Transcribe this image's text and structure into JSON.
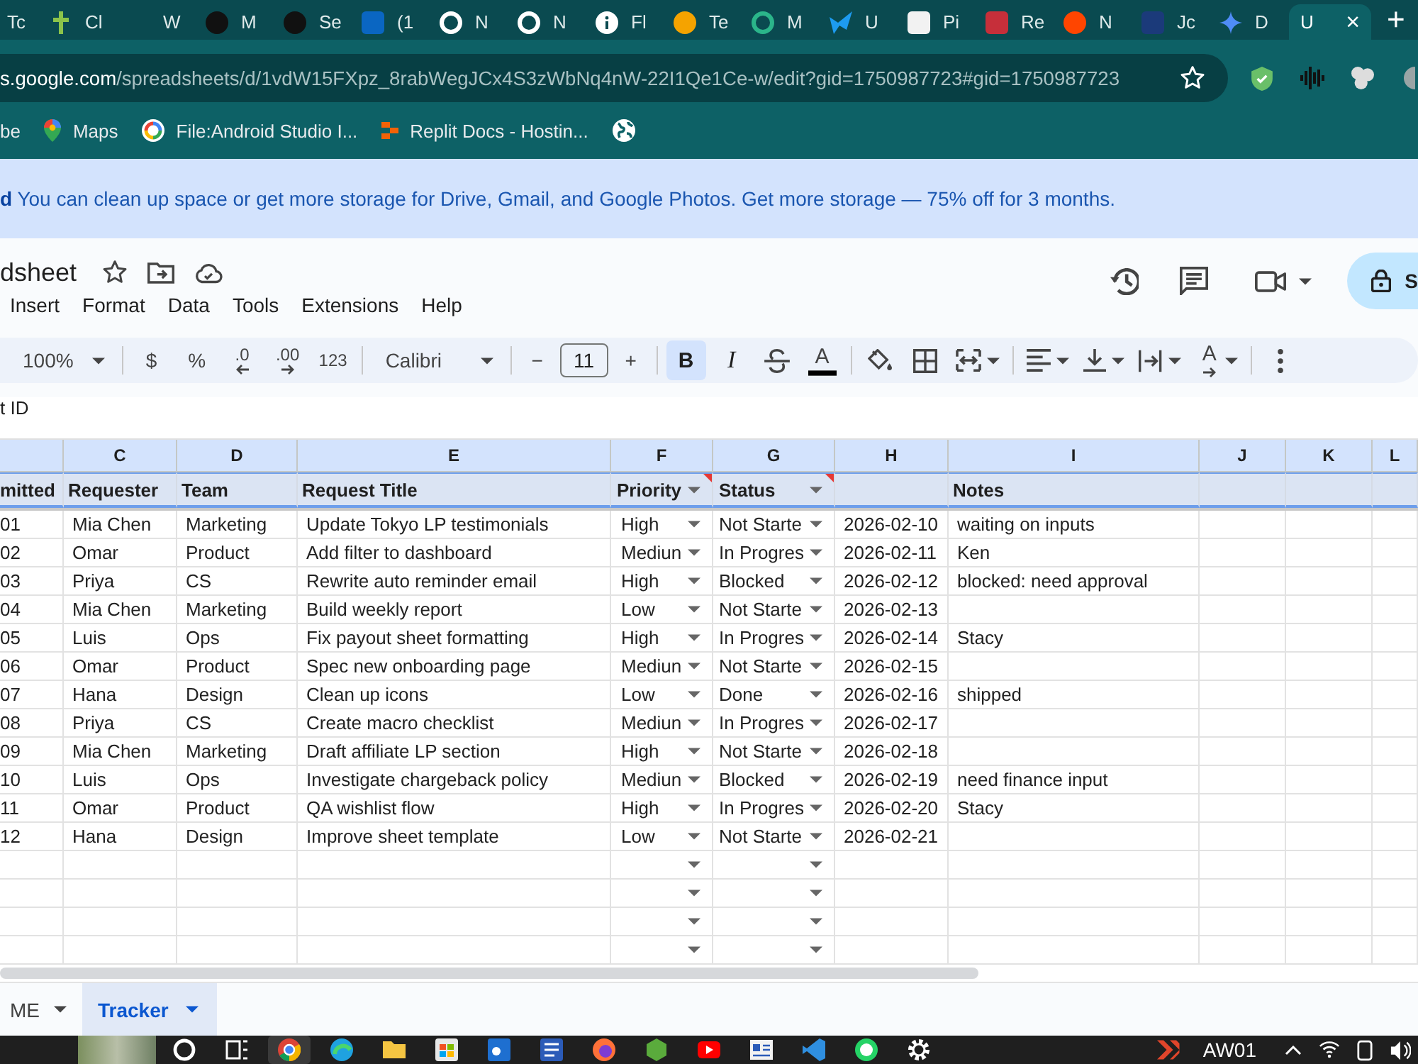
{
  "tabs": [
    {
      "label": "Tc",
      "selected": false
    },
    {
      "label": "Cl",
      "kind": "cross",
      "color": "#8bc34a",
      "selected": false
    },
    {
      "label": "W",
      "selected": false
    },
    {
      "label": "M",
      "kind": "disc",
      "color": "#111111",
      "selected": false
    },
    {
      "label": "Se",
      "kind": "disc",
      "color": "#111111",
      "selected": false
    },
    {
      "label": "(1",
      "kind": "square",
      "color": "#0a66c2",
      "selected": false
    },
    {
      "label": "N",
      "kind": "ring",
      "color": "#ffffff",
      "selected": false
    },
    {
      "label": "N",
      "kind": "ring",
      "color": "#ffffff",
      "selected": false
    },
    {
      "label": "Fl",
      "kind": "info",
      "color": "#ffffff",
      "selected": false
    },
    {
      "label": "Te",
      "kind": "disc",
      "color": "#f5a300",
      "selected": false
    },
    {
      "label": "M",
      "kind": "ring",
      "color": "#2bb58a",
      "selected": false
    },
    {
      "label": "U",
      "kind": "bird",
      "color": "#1d9bf0",
      "selected": false
    },
    {
      "label": "Pi",
      "kind": "square",
      "color": "#f2f2f2",
      "selected": false
    },
    {
      "label": "Re",
      "kind": "square",
      "color": "#c62f3a",
      "selected": false
    },
    {
      "label": "N",
      "kind": "disc",
      "color": "#ff4500",
      "selected": false
    },
    {
      "label": "Jc",
      "kind": "square",
      "color": "#1b3a7a",
      "selected": false
    },
    {
      "label": "D",
      "kind": "sparkle",
      "color": "#4f8cf7",
      "selected": false
    },
    {
      "label": "U",
      "selected": true,
      "close": "×"
    }
  ],
  "new_tab": "+",
  "address_bar": {
    "host": "s.google.com",
    "path": "/spreadsheets/d/1vdW15FXpz_8rabWegJCx4S3zWbNq4nW-22I1Qe1Ce-w/edit?gid=1750987723#gid=1750987723"
  },
  "bookmarks": [
    {
      "label": "be"
    },
    {
      "label": "Maps",
      "kind": "pin"
    },
    {
      "label": "File:Android Studio I...",
      "kind": "ring"
    },
    {
      "label": "Replit Docs - Hostin...",
      "kind": "blocks"
    },
    {
      "kind": "globe"
    }
  ],
  "banner": {
    "message": "**d** You can clean up space or get more storage for Drive, Gmail, and Google Photos. Get more storage — 75% off for 3 months."
  },
  "document": {
    "title": "dsheet",
    "menu": [
      "Insert",
      "Format",
      "Data",
      "Tools",
      "Extensions",
      "Help"
    ],
    "share": "S"
  },
  "toolbar": [
    {
      "kind": "zoom",
      "label": "100%"
    },
    {
      "kind": "divider"
    },
    {
      "kind": "currency",
      "label": "$"
    },
    {
      "kind": "percent",
      "label": "%"
    },
    {
      "kind": "decrease-decimal",
      "label": ".0"
    },
    {
      "kind": "increase-decimal",
      "label": ".00"
    },
    {
      "kind": "number-format",
      "label": "123"
    },
    {
      "kind": "divider"
    },
    {
      "kind": "font",
      "label": "Calibri"
    },
    {
      "kind": "divider"
    },
    {
      "kind": "font-size",
      "minus": "−",
      "value": "11",
      "plus": "+"
    },
    {
      "kind": "divider"
    },
    {
      "kind": "bold",
      "label": "B",
      "selected": true
    },
    {
      "kind": "italic",
      "label": "I",
      "selected": false
    },
    {
      "kind": "strikethrough"
    },
    {
      "kind": "text-color",
      "label": "A"
    },
    {
      "kind": "divider"
    },
    {
      "kind": "fill"
    },
    {
      "kind": "borders"
    },
    {
      "kind": "merge"
    },
    {
      "kind": "divider"
    },
    {
      "kind": "align"
    },
    {
      "kind": "valign"
    },
    {
      "kind": "wrap"
    },
    {
      "kind": "rotate",
      "label": "A"
    },
    {
      "kind": "divider"
    },
    {
      "kind": "more"
    }
  ],
  "formula_bar": {
    "value": "t ID"
  },
  "table": {
    "columns": [
      {
        "title": "mitted",
        "kind": "text",
        "filter": false,
        "note": false
      },
      {
        "letter": "C",
        "title": "Requester",
        "kind": "text",
        "filter": false,
        "note": false
      },
      {
        "letter": "D",
        "title": "Team",
        "kind": "text",
        "filter": false,
        "note": false
      },
      {
        "letter": "E",
        "title": "Request Title",
        "kind": "text",
        "filter": false,
        "note": false
      },
      {
        "letter": "F",
        "title": "Priority",
        "kind": "dropdown",
        "filter": true,
        "note": true
      },
      {
        "letter": "G",
        "title": "Status",
        "kind": "dropdown",
        "filter": true,
        "note": true
      },
      {
        "letter": "H",
        "kind": "text",
        "filter": false,
        "note": false
      },
      {
        "letter": "I",
        "title": "Notes",
        "kind": "text",
        "filter": false,
        "note": false
      },
      {
        "letter": "J",
        "kind": "text",
        "filter": false,
        "note": false
      },
      {
        "letter": "K",
        "kind": "text",
        "filter": false,
        "note": false
      },
      {
        "letter": "L",
        "kind": "text",
        "filter": false,
        "note": false
      }
    ],
    "header_row": {
      "selected": true
    },
    "rows": [
      {
        "cells": [
          "01",
          "Mia Chen",
          "Marketing",
          "Update Tokyo LP testimonials",
          "High",
          "Not Starte",
          "2026-02-10",
          "waiting on inputs"
        ],
        "dropdowns": true
      },
      {
        "cells": [
          "02",
          "Omar",
          "Product",
          "Add filter to dashboard",
          "Mediun",
          "In Progres",
          "2026-02-11",
          "Ken"
        ],
        "dropdowns": true
      },
      {
        "cells": [
          "03",
          "Priya",
          "CS",
          "Rewrite auto reminder email",
          "High",
          "Blocked",
          "2026-02-12",
          "blocked: need approval"
        ],
        "dropdowns": true
      },
      {
        "cells": [
          "04",
          "Mia Chen",
          "Marketing",
          "Build weekly report",
          "Low",
          "Not Starte",
          "2026-02-13"
        ],
        "dropdowns": true
      },
      {
        "cells": [
          "05",
          "Luis",
          "Ops",
          "Fix payout sheet formatting",
          "High",
          "In Progres",
          "2026-02-14",
          "Stacy"
        ],
        "dropdowns": true
      },
      {
        "cells": [
          "06",
          "Omar",
          "Product",
          "Spec new onboarding page",
          "Mediun",
          "Not Starte",
          "2026-02-15"
        ],
        "dropdowns": true
      },
      {
        "cells": [
          "07",
          "Hana",
          "Design",
          "Clean up icons",
          "Low",
          "Done",
          "2026-02-16",
          "shipped"
        ],
        "dropdowns": true
      },
      {
        "cells": [
          "08",
          "Priya",
          "CS",
          "Create macro checklist",
          "Mediun",
          "In Progres",
          "2026-02-17"
        ],
        "dropdowns": true
      },
      {
        "cells": [
          "09",
          "Mia Chen",
          "Marketing",
          "Draft affiliate LP section",
          "High",
          "Not Starte",
          "2026-02-18"
        ],
        "dropdowns": true
      },
      {
        "cells": [
          "10",
          "Luis",
          "Ops",
          "Investigate chargeback policy",
          "Mediun",
          "Blocked",
          "2026-02-19",
          "need finance input"
        ],
        "dropdowns": true
      },
      {
        "cells": [
          "11",
          "Omar",
          "Product",
          "QA wishlist flow",
          "High",
          "In Progres",
          "2026-02-20",
          "Stacy"
        ],
        "dropdowns": true
      },
      {
        "cells": [
          "12",
          "Hana",
          "Design",
          "Improve sheet template",
          "Low",
          "Not Starte",
          "2026-02-21"
        ],
        "dropdowns": true
      },
      {
        "dropdowns": true
      },
      {
        "dropdowns": true
      },
      {
        "dropdowns": true
      },
      {
        "dropdowns": true
      }
    ]
  },
  "sheet_tabs": [
    {
      "label": "ME",
      "selected": false
    },
    {
      "label": "Tracker",
      "selected": true
    }
  ],
  "taskbar": {
    "apps": [
      {
        "kind": "search",
        "selected": false
      },
      {
        "kind": "tasks",
        "selected": false
      },
      {
        "kind": "browser",
        "selected": true
      },
      {
        "kind": "swirl",
        "selected": false
      },
      {
        "kind": "folder",
        "selected": false
      },
      {
        "kind": "store",
        "selected": false
      },
      {
        "kind": "mail",
        "selected": false
      },
      {
        "kind": "document",
        "selected": false
      },
      {
        "kind": "fox",
        "selected": false
      },
      {
        "kind": "cube",
        "selected": false
      },
      {
        "kind": "video",
        "selected": false
      },
      {
        "kind": "news",
        "selected": false
      },
      {
        "kind": "code",
        "selected": false
      },
      {
        "kind": "chat",
        "selected": false
      },
      {
        "kind": "gear",
        "selected": false
      }
    ],
    "tray_label": "AW01"
  }
}
